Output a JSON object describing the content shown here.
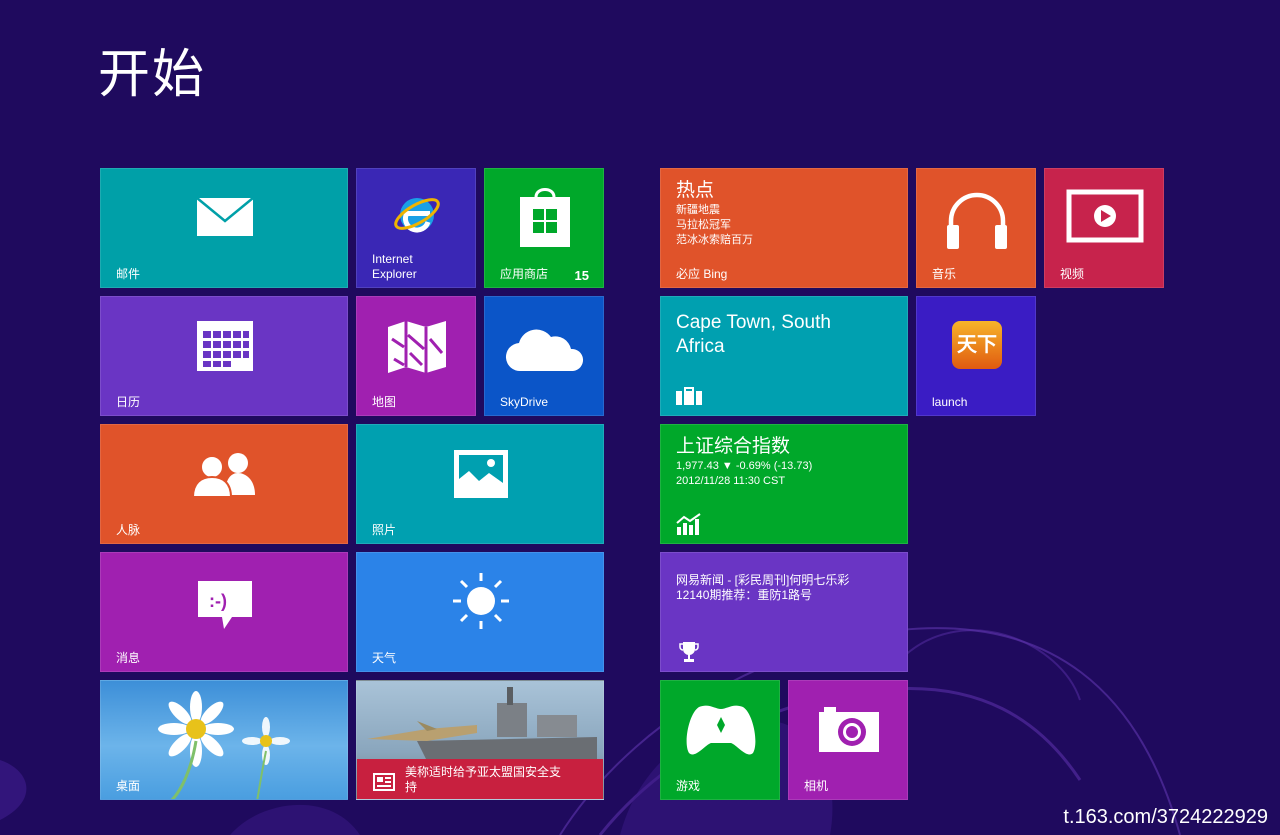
{
  "start_title": "开始",
  "tiles": {
    "mail": {
      "label": "邮件"
    },
    "ie": {
      "label_line1": "Internet",
      "label_line2": "Explorer"
    },
    "store": {
      "label": "应用商店",
      "badge": "15"
    },
    "bing": {
      "heading": "热点",
      "items": [
        "新疆地震",
        "马拉松冠军",
        "范冰冰索赔百万"
      ],
      "label": "必应 Bing"
    },
    "music": {
      "label": "音乐"
    },
    "video": {
      "label": "视频"
    },
    "calendar": {
      "label": "日历"
    },
    "maps": {
      "label": "地图"
    },
    "skydrive": {
      "label": "SkyDrive"
    },
    "travel": {
      "line1": "Cape Town, South",
      "line2": "Africa"
    },
    "launch": {
      "label": "launch",
      "app_text": "天下"
    },
    "people": {
      "label": "人脉"
    },
    "photos": {
      "label": "照片"
    },
    "finance": {
      "heading": "上证综合指数",
      "quote": "1,977.43  ▼ -0.69% (-13.73)",
      "time": "2012/11/28 11:30 CST"
    },
    "messaging": {
      "label": "消息",
      "emoticon": ":-)"
    },
    "weather": {
      "label": "天气"
    },
    "sports": {
      "line1": "网易新闻 - [彩民周刊]何明七乐彩",
      "line2": "12140期推荐：重防1路号"
    },
    "desktop": {
      "label": "桌面"
    },
    "news": {
      "line1": "美称适时给予亚太盟国安全支",
      "line2": "持"
    },
    "games": {
      "label": "游戏"
    },
    "camera": {
      "label": "相机"
    }
  },
  "watermark": "t.163.com/3724222929"
}
